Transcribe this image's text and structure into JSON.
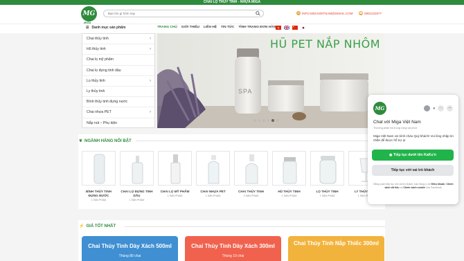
{
  "topbar": {
    "text": "CHAI LỌ THỦY TINH - NHỰA MIGA"
  },
  "logo": {
    "mark": "MG",
    "name": "MIGA"
  },
  "search": {
    "placeholder": "Bạn tìm gì hôm nay",
    "icon": "search-icon"
  },
  "contact": {
    "email": "INFO.MIGAVIETNAM@GMAIL.COM",
    "phone": "0901222577"
  },
  "categories_button": "Danh mục sản phẩm",
  "nav": {
    "items": [
      "TRANG CHỦ",
      "GIỚI THIỆU",
      "LIÊN HỆ",
      "TIN TỨC",
      "TÌNH TRẠNG ĐƠN HÀNG"
    ]
  },
  "sidemenu": {
    "items": [
      {
        "label": "Chai thủy tinh",
        "arrow": "›"
      },
      {
        "label": "Hũ thủy tinh",
        "arrow": "›"
      },
      {
        "label": "Chai lọ mỹ phẩm",
        "arrow": ""
      },
      {
        "label": "Chai lọ đựng tinh dầu",
        "arrow": ""
      },
      {
        "label": "Lọ thủy tinh",
        "arrow": "›"
      },
      {
        "label": "Ly thủy tinh",
        "arrow": ""
      },
      {
        "label": "Bình thủy tinh đựng nước",
        "arrow": ""
      },
      {
        "label": "Chai nhựa PET",
        "arrow": "›"
      },
      {
        "label": "Nắp nút – Phụ kiện",
        "arrow": ""
      }
    ]
  },
  "banner": {
    "title": "HŨ PET NẮP NHÔM",
    "jar_label": "SPA"
  },
  "featured": {
    "title": "NGÀNH HÀNG NỔI BẬT",
    "items": [
      {
        "name": "BÌNH THỦY TINH ĐỰNG NƯỚC",
        "count": "1 SẢN PHẨM"
      },
      {
        "name": "CHAI LỌ ĐỰNG TINH DẦU",
        "count": "1 SẢN PHẨM"
      },
      {
        "name": "CHAI LỌ MỸ PHẨM",
        "count": "1 SẢN PHẨM"
      },
      {
        "name": "CHAI NHỰA PET",
        "count": "1 SẢN PHẨM"
      },
      {
        "name": "CHAI THỦY TINH",
        "count": "3 SẢN PHẨM"
      },
      {
        "name": "HŨ THỦY TINH",
        "count": "1 SẢN PHẨM"
      },
      {
        "name": "LỌ THỦY TINH",
        "count": "1 SẢN PHẨM"
      },
      {
        "name": "LY THỦY TINH",
        "count": "1 SẢN PHẨM"
      }
    ]
  },
  "best_price": {
    "title": "GIÁ TỐT NHẤT",
    "cards": [
      {
        "title": "Chai Thủy Tinh Dày Xách 500ml",
        "sub": "Thùng 80 chai",
        "color": "#3f8fd2"
      },
      {
        "title": "Chai Thủy Tinh Dày Xách 300ml",
        "sub": "Thùng 10 chai",
        "color": "#f0624e"
      },
      {
        "title": "Chai Thủy Tinh Nắp Thiếc 300ml",
        "sub": "",
        "color": "#f2b33d"
      }
    ]
  },
  "chat": {
    "logo": "MG",
    "title": "Chat với Miga Việt Nam",
    "subtitle": "Thường phản hồi trong vòng vài phút",
    "message": "Miga Việt Nam xin kính chào Quý khách! Vui lòng nhập tin nhắn để được hỗ trợ ạ!",
    "primary_button": "Tiếp tục dưới tên KaKu'n",
    "secondary_button": "Tiếp tục với vai trò khách",
    "terms_prefix": "Bằng cách tiếp tục với vai trò khách, bạn đồng ý với",
    "terms_link": "Điều khoản",
    "terms_middle": "Chính sách dữ liệu",
    "terms_and": "và",
    "terms_cookie": "Chính sách cookie",
    "terms_suffix": "của Facebook."
  },
  "colors": {
    "brand": "#2e8b3c",
    "accent": "#21b44b"
  }
}
